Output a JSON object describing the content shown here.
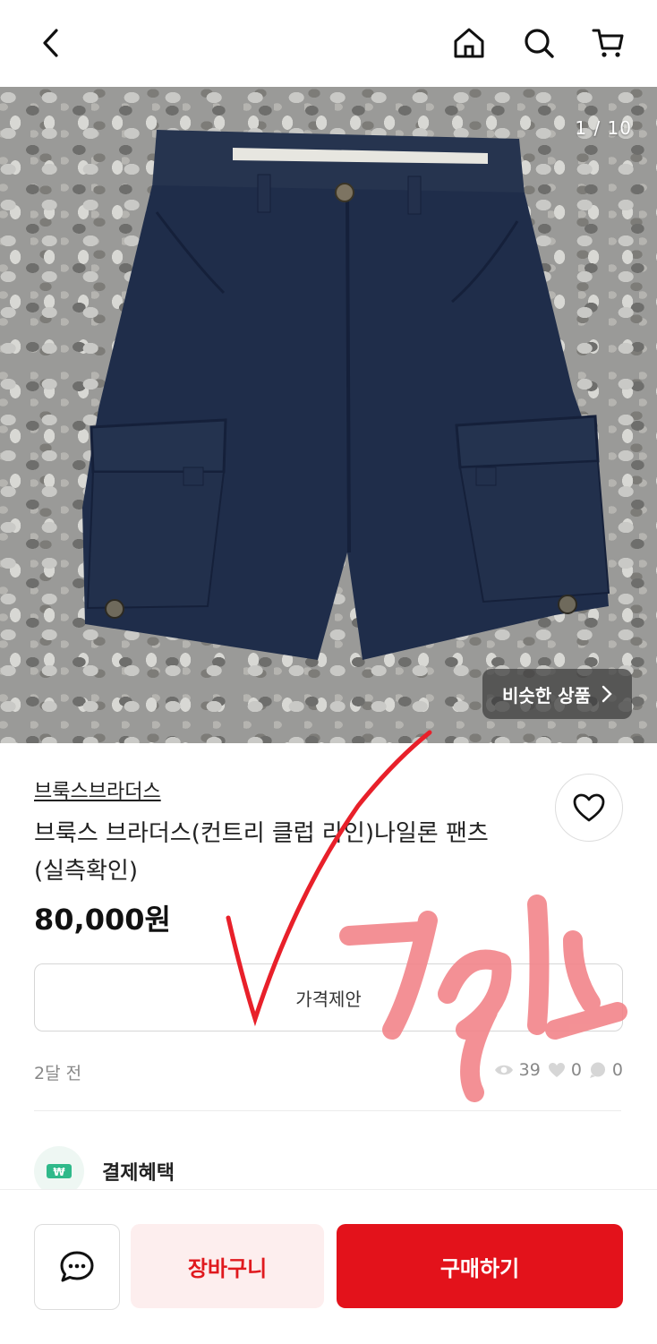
{
  "header": {
    "back_icon": "chevron-left-icon",
    "home_icon": "home-icon",
    "search_icon": "search-icon",
    "cart_icon": "cart-icon"
  },
  "gallery": {
    "counter": "1 / 10",
    "similar_label": "비슷한 상품"
  },
  "product": {
    "brand": "브룩스브라더스",
    "title": "브룩스 브라더스(컨트리 클럽 라인)나일론 팬츠 (실측확인)",
    "price": "80,000원",
    "offer_label": "가격제안",
    "posted": "2달 전",
    "views": "39",
    "likes": "0",
    "chats": "0"
  },
  "benefit": {
    "label": "결제혜택"
  },
  "bottom": {
    "cart_label": "장바구니",
    "buy_label": "구매하기"
  },
  "colors": {
    "accent": "#e3121b",
    "cart_bg": "#fdeeee"
  }
}
